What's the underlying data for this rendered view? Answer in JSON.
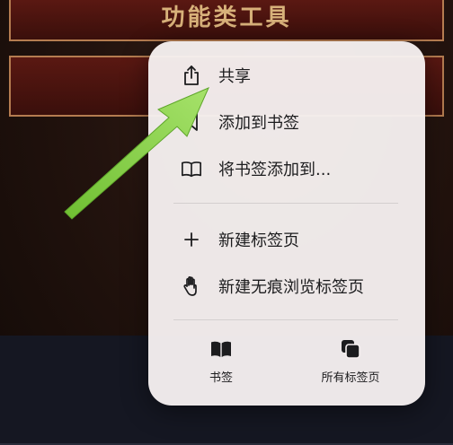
{
  "background": {
    "title_button_text": "功能类工具"
  },
  "menu": {
    "items": [
      {
        "label": "共享",
        "icon": "share-icon"
      },
      {
        "label": "添加到书签",
        "icon": "bookmark-icon"
      },
      {
        "label": "将书签添加到...",
        "icon": "book-icon"
      },
      {
        "label": "新建标签页",
        "icon": "plus-icon"
      },
      {
        "label": "新建无痕浏览标签页",
        "icon": "hand-icon"
      }
    ],
    "bottom_actions": [
      {
        "label": "书签",
        "icon": "bookmarks-icon"
      },
      {
        "label": "所有标签页",
        "icon": "tabs-icon"
      }
    ]
  },
  "colors": {
    "arrow": "#8fd14f",
    "menu_bg": "#f6f0f0",
    "title_text": "#d8b17a"
  }
}
